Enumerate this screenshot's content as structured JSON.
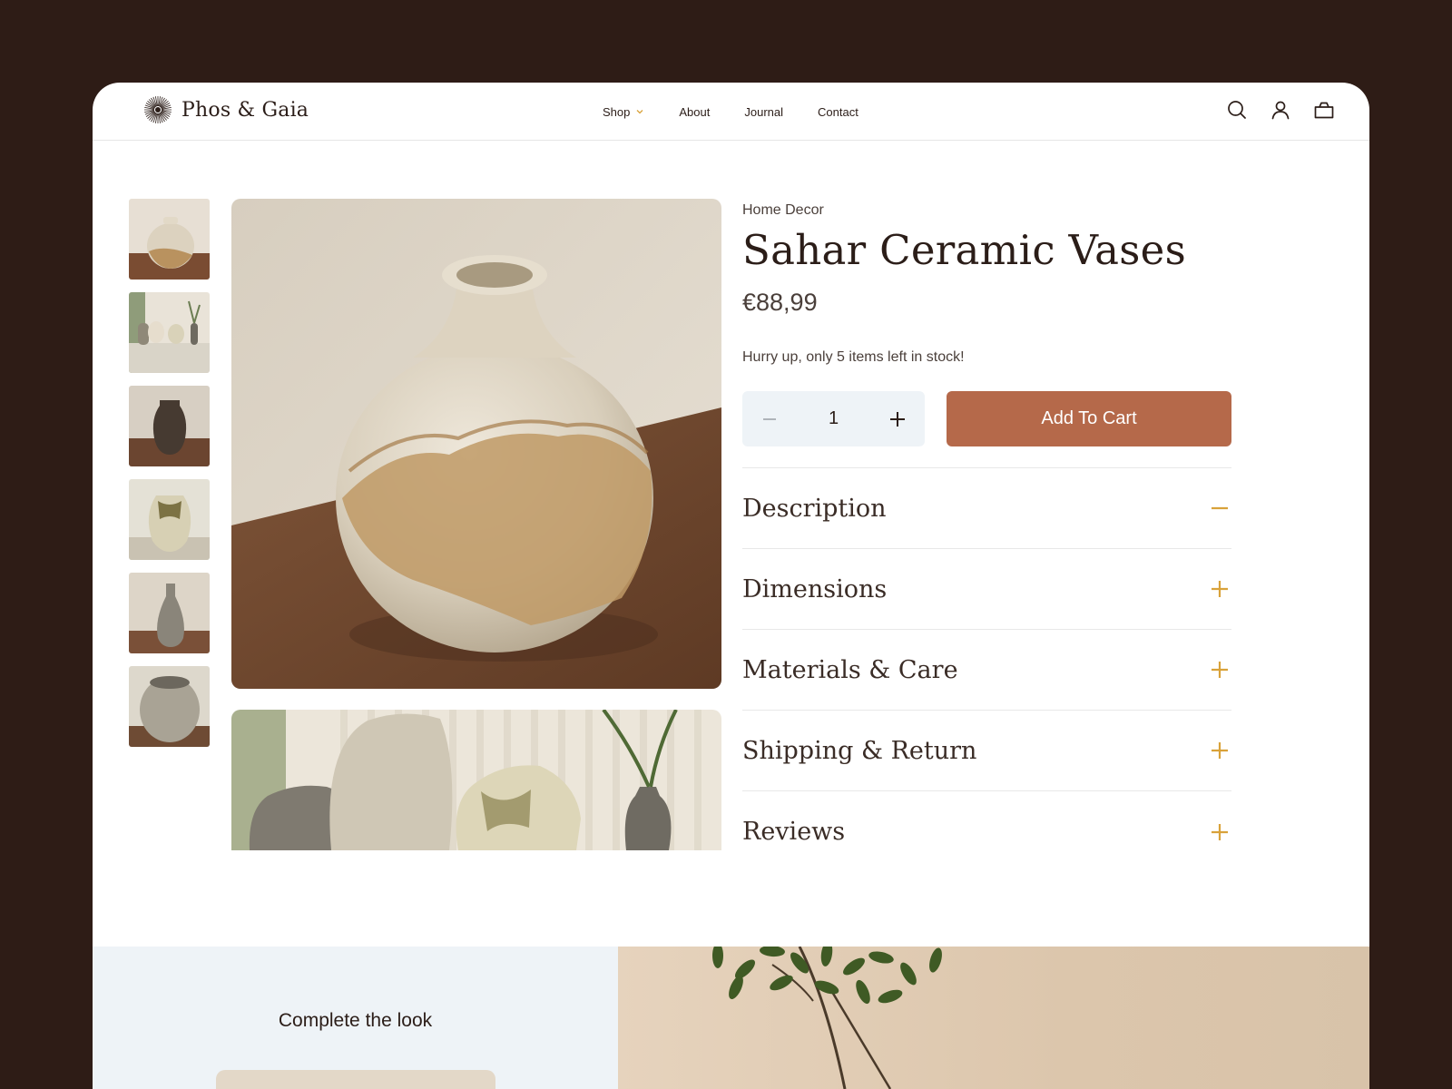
{
  "header": {
    "brand_name": "Phos & Gaia",
    "nav": [
      {
        "label": "Shop",
        "has_dropdown": true
      },
      {
        "label": "About"
      },
      {
        "label": "Journal"
      },
      {
        "label": "Contact"
      }
    ],
    "icons": [
      "search-icon",
      "account-icon",
      "cart-icon"
    ]
  },
  "gallery": {
    "thumbnail_count": 6
  },
  "product": {
    "category": "Home Decor",
    "title": "Sahar Ceramic Vases",
    "price": "€88,99",
    "stock_note": "Hurry up, only 5 items left in stock!",
    "quantity": "1",
    "add_to_cart_label": "Add To Cart"
  },
  "accordion": [
    {
      "title": "Description",
      "expanded": true
    },
    {
      "title": "Dimensions",
      "expanded": false
    },
    {
      "title": "Materials & Care",
      "expanded": false
    },
    {
      "title": "Shipping & Return",
      "expanded": false
    },
    {
      "title": "Reviews",
      "expanded": false
    }
  ],
  "complete_look": {
    "title": "Complete the look"
  },
  "colors": {
    "background": "#2e1c16",
    "accent_button": "#b5694a",
    "accordion_icon": "#d9a23a",
    "soft_panel": "#eef3f7"
  }
}
